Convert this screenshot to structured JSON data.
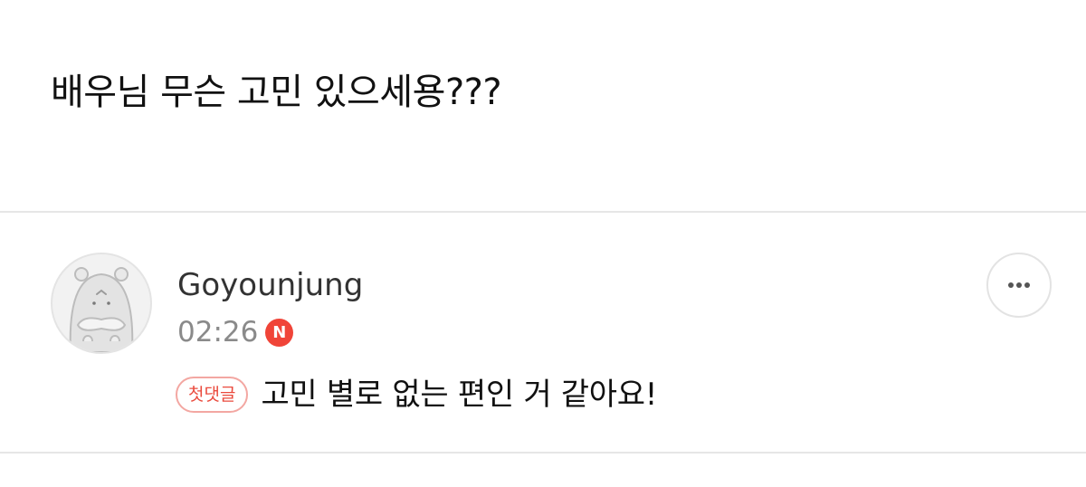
{
  "post": {
    "text": "배우님 무슨 고민 있으세용???"
  },
  "comment": {
    "author": "Goyounjung",
    "time": "02:26",
    "new_badge": "N",
    "first_tag": "첫댓글",
    "text": "고민 별로 없는 편인 거 같아요!",
    "avatar_icon": "hamster-mascot-icon",
    "more_icon": "more-dots-icon"
  },
  "colors": {
    "badge_red": "#f04438",
    "tag_text": "#ea4b3e",
    "tag_border": "#f3a7a2",
    "muted": "#8a8a8a",
    "divider": "#e6e6e6"
  }
}
